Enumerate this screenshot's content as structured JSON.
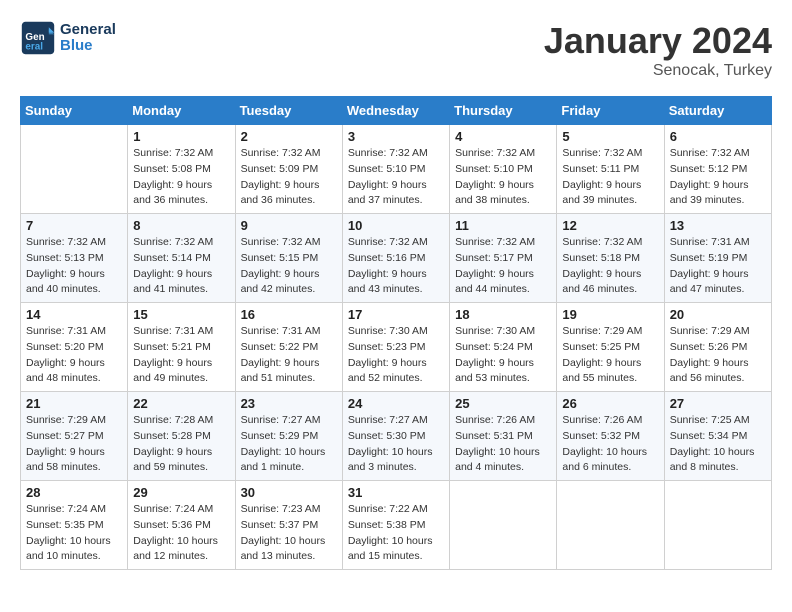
{
  "header": {
    "logo_general": "General",
    "logo_blue": "Blue",
    "month_title": "January 2024",
    "location": "Senocak, Turkey"
  },
  "weekdays": [
    "Sunday",
    "Monday",
    "Tuesday",
    "Wednesday",
    "Thursday",
    "Friday",
    "Saturday"
  ],
  "weeks": [
    [
      {
        "day": "",
        "sunrise": "",
        "sunset": "",
        "daylight": ""
      },
      {
        "day": "1",
        "sunrise": "Sunrise: 7:32 AM",
        "sunset": "Sunset: 5:08 PM",
        "daylight": "Daylight: 9 hours and 36 minutes."
      },
      {
        "day": "2",
        "sunrise": "Sunrise: 7:32 AM",
        "sunset": "Sunset: 5:09 PM",
        "daylight": "Daylight: 9 hours and 36 minutes."
      },
      {
        "day": "3",
        "sunrise": "Sunrise: 7:32 AM",
        "sunset": "Sunset: 5:10 PM",
        "daylight": "Daylight: 9 hours and 37 minutes."
      },
      {
        "day": "4",
        "sunrise": "Sunrise: 7:32 AM",
        "sunset": "Sunset: 5:10 PM",
        "daylight": "Daylight: 9 hours and 38 minutes."
      },
      {
        "day": "5",
        "sunrise": "Sunrise: 7:32 AM",
        "sunset": "Sunset: 5:11 PM",
        "daylight": "Daylight: 9 hours and 39 minutes."
      },
      {
        "day": "6",
        "sunrise": "Sunrise: 7:32 AM",
        "sunset": "Sunset: 5:12 PM",
        "daylight": "Daylight: 9 hours and 39 minutes."
      }
    ],
    [
      {
        "day": "7",
        "sunrise": "Sunrise: 7:32 AM",
        "sunset": "Sunset: 5:13 PM",
        "daylight": "Daylight: 9 hours and 40 minutes."
      },
      {
        "day": "8",
        "sunrise": "Sunrise: 7:32 AM",
        "sunset": "Sunset: 5:14 PM",
        "daylight": "Daylight: 9 hours and 41 minutes."
      },
      {
        "day": "9",
        "sunrise": "Sunrise: 7:32 AM",
        "sunset": "Sunset: 5:15 PM",
        "daylight": "Daylight: 9 hours and 42 minutes."
      },
      {
        "day": "10",
        "sunrise": "Sunrise: 7:32 AM",
        "sunset": "Sunset: 5:16 PM",
        "daylight": "Daylight: 9 hours and 43 minutes."
      },
      {
        "day": "11",
        "sunrise": "Sunrise: 7:32 AM",
        "sunset": "Sunset: 5:17 PM",
        "daylight": "Daylight: 9 hours and 44 minutes."
      },
      {
        "day": "12",
        "sunrise": "Sunrise: 7:32 AM",
        "sunset": "Sunset: 5:18 PM",
        "daylight": "Daylight: 9 hours and 46 minutes."
      },
      {
        "day": "13",
        "sunrise": "Sunrise: 7:31 AM",
        "sunset": "Sunset: 5:19 PM",
        "daylight": "Daylight: 9 hours and 47 minutes."
      }
    ],
    [
      {
        "day": "14",
        "sunrise": "Sunrise: 7:31 AM",
        "sunset": "Sunset: 5:20 PM",
        "daylight": "Daylight: 9 hours and 48 minutes."
      },
      {
        "day": "15",
        "sunrise": "Sunrise: 7:31 AM",
        "sunset": "Sunset: 5:21 PM",
        "daylight": "Daylight: 9 hours and 49 minutes."
      },
      {
        "day": "16",
        "sunrise": "Sunrise: 7:31 AM",
        "sunset": "Sunset: 5:22 PM",
        "daylight": "Daylight: 9 hours and 51 minutes."
      },
      {
        "day": "17",
        "sunrise": "Sunrise: 7:30 AM",
        "sunset": "Sunset: 5:23 PM",
        "daylight": "Daylight: 9 hours and 52 minutes."
      },
      {
        "day": "18",
        "sunrise": "Sunrise: 7:30 AM",
        "sunset": "Sunset: 5:24 PM",
        "daylight": "Daylight: 9 hours and 53 minutes."
      },
      {
        "day": "19",
        "sunrise": "Sunrise: 7:29 AM",
        "sunset": "Sunset: 5:25 PM",
        "daylight": "Daylight: 9 hours and 55 minutes."
      },
      {
        "day": "20",
        "sunrise": "Sunrise: 7:29 AM",
        "sunset": "Sunset: 5:26 PM",
        "daylight": "Daylight: 9 hours and 56 minutes."
      }
    ],
    [
      {
        "day": "21",
        "sunrise": "Sunrise: 7:29 AM",
        "sunset": "Sunset: 5:27 PM",
        "daylight": "Daylight: 9 hours and 58 minutes."
      },
      {
        "day": "22",
        "sunrise": "Sunrise: 7:28 AM",
        "sunset": "Sunset: 5:28 PM",
        "daylight": "Daylight: 9 hours and 59 minutes."
      },
      {
        "day": "23",
        "sunrise": "Sunrise: 7:27 AM",
        "sunset": "Sunset: 5:29 PM",
        "daylight": "Daylight: 10 hours and 1 minute."
      },
      {
        "day": "24",
        "sunrise": "Sunrise: 7:27 AM",
        "sunset": "Sunset: 5:30 PM",
        "daylight": "Daylight: 10 hours and 3 minutes."
      },
      {
        "day": "25",
        "sunrise": "Sunrise: 7:26 AM",
        "sunset": "Sunset: 5:31 PM",
        "daylight": "Daylight: 10 hours and 4 minutes."
      },
      {
        "day": "26",
        "sunrise": "Sunrise: 7:26 AM",
        "sunset": "Sunset: 5:32 PM",
        "daylight": "Daylight: 10 hours and 6 minutes."
      },
      {
        "day": "27",
        "sunrise": "Sunrise: 7:25 AM",
        "sunset": "Sunset: 5:34 PM",
        "daylight": "Daylight: 10 hours and 8 minutes."
      }
    ],
    [
      {
        "day": "28",
        "sunrise": "Sunrise: 7:24 AM",
        "sunset": "Sunset: 5:35 PM",
        "daylight": "Daylight: 10 hours and 10 minutes."
      },
      {
        "day": "29",
        "sunrise": "Sunrise: 7:24 AM",
        "sunset": "Sunset: 5:36 PM",
        "daylight": "Daylight: 10 hours and 12 minutes."
      },
      {
        "day": "30",
        "sunrise": "Sunrise: 7:23 AM",
        "sunset": "Sunset: 5:37 PM",
        "daylight": "Daylight: 10 hours and 13 minutes."
      },
      {
        "day": "31",
        "sunrise": "Sunrise: 7:22 AM",
        "sunset": "Sunset: 5:38 PM",
        "daylight": "Daylight: 10 hours and 15 minutes."
      },
      {
        "day": "",
        "sunrise": "",
        "sunset": "",
        "daylight": ""
      },
      {
        "day": "",
        "sunrise": "",
        "sunset": "",
        "daylight": ""
      },
      {
        "day": "",
        "sunrise": "",
        "sunset": "",
        "daylight": ""
      }
    ]
  ]
}
